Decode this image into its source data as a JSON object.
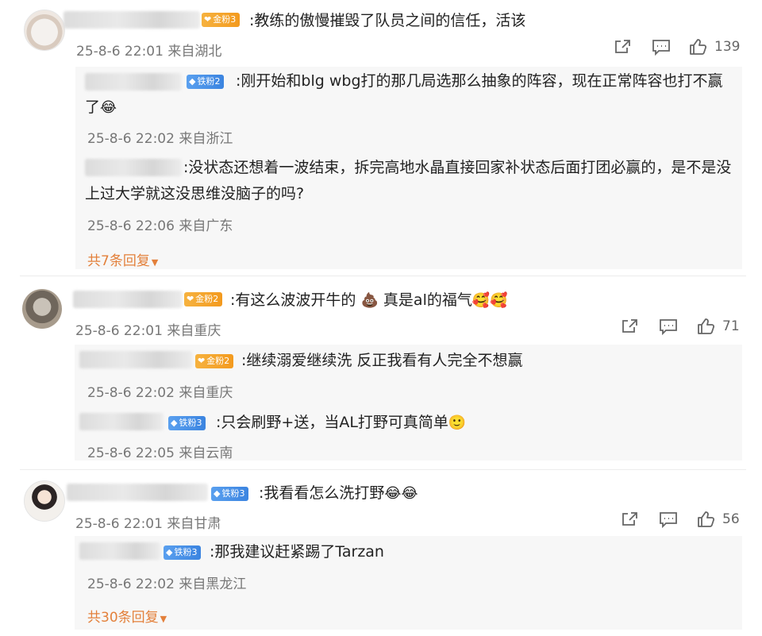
{
  "comments": [
    {
      "text": ":教练的傲慢摧毁了队员之间的信任，活该",
      "badge": "金粉3",
      "time": "25-8-6 22:01 来自湖北",
      "likes": "139",
      "replies": [
        {
          "badge": "铁粉2",
          "text": ":刚开始和blg wbg打的那几局选那么抽象的阵容，现在正常阵容也打不赢了",
          "emoji": "😂",
          "time": "25-8-6 22:02 来自浙江"
        },
        {
          "badge": "",
          "text": ":没状态还想着一波结束，拆完高地水晶直接回家补状态后面打团必赢的，是不是没上过大学就这没思维没脑子的吗?",
          "time": "25-8-6 22:06 来自广东"
        }
      ],
      "more": "共7条回复"
    },
    {
      "text": ":有这么波波开牛的",
      "emoji1": "💩",
      "text2": "真是al的福气",
      "emoji2": "🥰🥰",
      "badge": "金粉2",
      "time": "25-8-6 22:01 来自重庆",
      "likes": "71",
      "replies": [
        {
          "badge": "金粉2",
          "text": ":继续溺爱继续洗 反正我看有人完全不想赢",
          "time": "25-8-6 22:02 来自重庆"
        },
        {
          "badge": "铁粉3",
          "text": ":只会刷野+送，当AL打野可真简单",
          "emoji": "🙂",
          "time": "25-8-6 22:05 来自云南"
        }
      ]
    },
    {
      "text": ":我看看怎么洗打野",
      "emoji": "😂😂",
      "badge": "铁粉3",
      "time": "25-8-6 22:01 来自甘肃",
      "likes": "56",
      "replies": [
        {
          "badge": "铁粉3",
          "text": ":那我建议赶紧踢了Tarzan",
          "time": "25-8-6 22:02 来自黑龙江"
        }
      ],
      "more": "共30条回复"
    }
  ],
  "icons": {
    "share": "share-icon",
    "comment": "comment-icon",
    "like": "like-icon",
    "badge": "heart-badge-icon"
  },
  "colors": {
    "gold_badge": "#f39a1e",
    "iron_badge": "#3b84e0",
    "more_link": "#e3803b",
    "meta": "#777777"
  }
}
